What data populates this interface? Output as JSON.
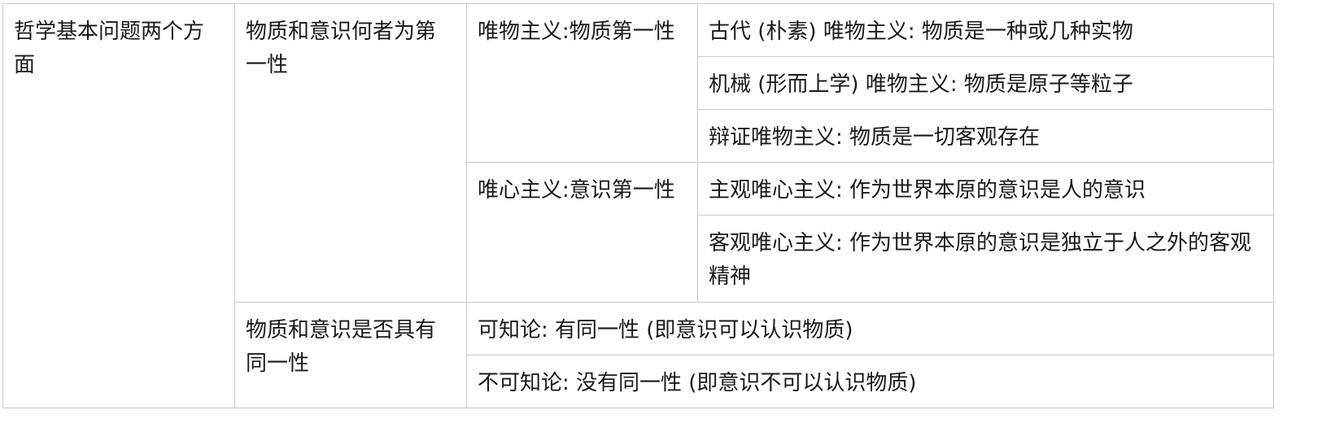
{
  "table": {
    "root_label": "哲学基本问题两个方面",
    "aspects": [
      {
        "label": "物质和意识何者为第一性",
        "schools": [
          {
            "label": "唯物主义:物质第一性",
            "items": [
              "古代 (朴素) 唯物主义: 物质是一种或几种实物",
              "机械 (形而上学) 唯物主义: 物质是原子等粒子",
              "辩证唯物主义: 物质是一切客观存在"
            ]
          },
          {
            "label": "唯心主义:意识第一性",
            "items": [
              "主观唯心主义: 作为世界本原的意识是人的意识",
              "客观唯心主义: 作为世界本原的意识是独立于人之外的客观精神"
            ]
          }
        ]
      },
      {
        "label": "物质和意识是否具有同一性",
        "items": [
          "可知论: 有同一性 (即意识可以认识物质)",
          "不可知论: 没有同一性 (即意识不可以认识物质)"
        ]
      }
    ]
  }
}
